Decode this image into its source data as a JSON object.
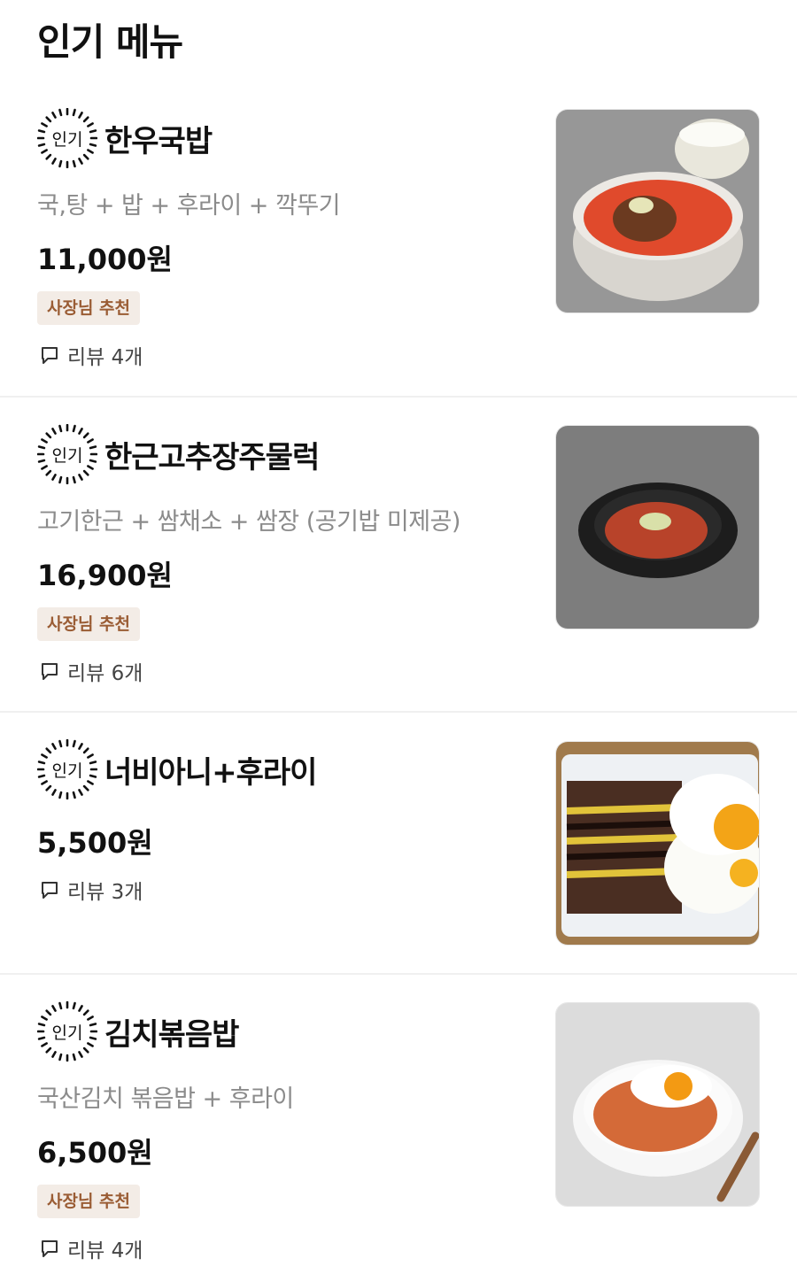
{
  "section_title": "인기 메뉴",
  "popular_badge": "인기",
  "items": [
    {
      "name": "한우국밥",
      "description": "국,탕 + 밥 + 후라이 + 깍뚜기",
      "price": "11,000원",
      "recommend": "사장님 추천",
      "reviews": "리뷰 4개",
      "image": "gukbap-photo"
    },
    {
      "name": "한근고추장주물럭",
      "description": "고기한근 + 쌈채소 + 쌈장 (공기밥 미제공)",
      "price": "16,900원",
      "recommend": "사장님 추천",
      "reviews": "리뷰 6개",
      "image": "gochujang-pork-photo"
    },
    {
      "name": "너비아니+후라이",
      "price": "5,500원",
      "reviews": "리뷰 3개",
      "image": "neobiani-egg-photo"
    },
    {
      "name": "김치볶음밥",
      "description": "국산김치 볶음밥 + 후라이",
      "price": "6,500원",
      "recommend": "사장님 추천",
      "reviews": "리뷰 4개",
      "image": "kimchi-fried-rice-photo"
    }
  ],
  "colors": {
    "recommend_bg": "#f3ece6",
    "recommend_text": "#9a5c34",
    "description": "#8b8b8b"
  }
}
